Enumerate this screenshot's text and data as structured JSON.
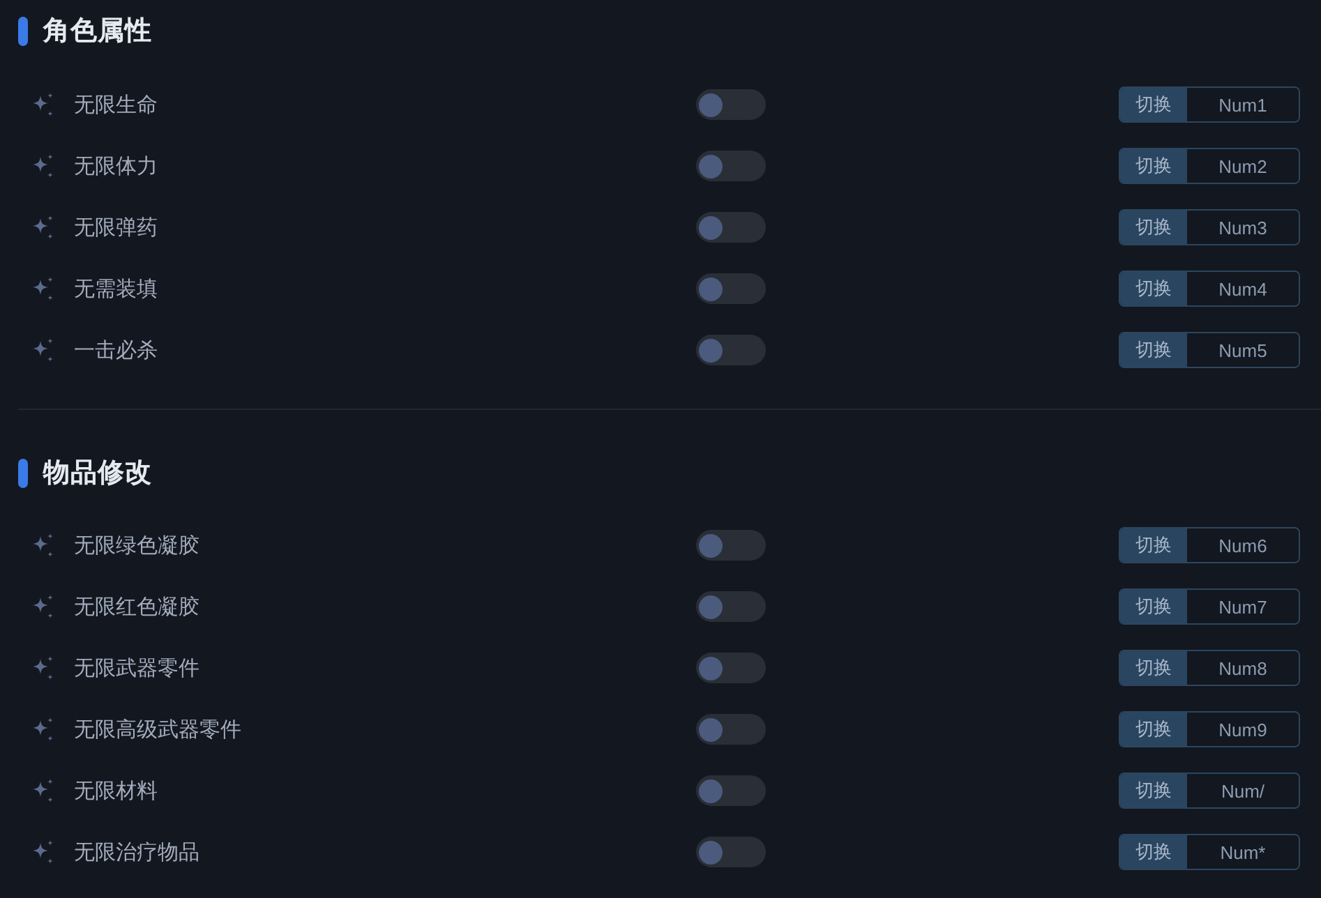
{
  "sections": [
    {
      "title": "角色属性",
      "items": [
        {
          "label": "无限生命",
          "on": false,
          "mode": "切换",
          "hotkey": "Num1"
        },
        {
          "label": "无限体力",
          "on": false,
          "mode": "切换",
          "hotkey": "Num2"
        },
        {
          "label": "无限弹药",
          "on": false,
          "mode": "切换",
          "hotkey": "Num3"
        },
        {
          "label": "无需装填",
          "on": false,
          "mode": "切换",
          "hotkey": "Num4"
        },
        {
          "label": "一击必杀",
          "on": false,
          "mode": "切换",
          "hotkey": "Num5"
        }
      ]
    },
    {
      "title": "物品修改",
      "items": [
        {
          "label": "无限绿色凝胶",
          "on": false,
          "mode": "切换",
          "hotkey": "Num6"
        },
        {
          "label": "无限红色凝胶",
          "on": false,
          "mode": "切换",
          "hotkey": "Num7"
        },
        {
          "label": "无限武器零件",
          "on": false,
          "mode": "切换",
          "hotkey": "Num8"
        },
        {
          "label": "无限高级武器零件",
          "on": false,
          "mode": "切换",
          "hotkey": "Num9"
        },
        {
          "label": "无限材料",
          "on": false,
          "mode": "切换",
          "hotkey": "Num/"
        },
        {
          "label": "无限治疗物品",
          "on": false,
          "mode": "切换",
          "hotkey": "Num*"
        }
      ]
    }
  ]
}
